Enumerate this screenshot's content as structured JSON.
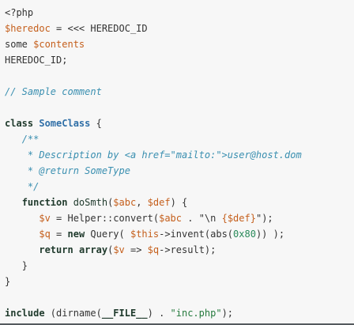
{
  "tokens": {
    "l1_open": "<?php",
    "l2_var": "$heredoc",
    "l2_rest": " = <<< HEREDOC_ID",
    "l3_text": "some ",
    "l3_var": "$contents",
    "l4_text": "HEREDOC_ID;",
    "l6_comment": "// Sample comment",
    "l8_kw": "class",
    "l8_cls": "SomeClass",
    "l8_rest": " {",
    "l9_doc": "/**",
    "l10_doc_a": " * Description by <a href=\"mailto:\">user@host.dom",
    "l11_doc": " * @return SomeType",
    "l12_doc": " */",
    "l13_kw": "function",
    "l13_fn": " doSmth",
    "l13_p1": "(",
    "l13_v1": "$abc",
    "l13_p2": ", ",
    "l13_v2": "$def",
    "l13_p3": ") {",
    "l14_var": "$v",
    "l14_a": " = Helper::",
    "l14_fn": "convert",
    "l14_b": "(",
    "l14_v2": "$abc",
    "l14_c": " . ",
    "l14_str1": "\"\\n ",
    "l14_strv": "{$def}",
    "l14_str2": "\"",
    "l14_d": ");",
    "l15_var": "$q",
    "l15_a": " = ",
    "l15_kw": "new",
    "l15_b": " Query( ",
    "l15_this": "$this",
    "l15_c": "->invent(abs(",
    "l15_num": "0x80",
    "l15_d": ")) );",
    "l16_kw1": "return",
    "l16_sp": " ",
    "l16_kw2": "array",
    "l16_a": "(",
    "l16_v1": "$v",
    "l16_b": " => ",
    "l16_v2": "$q",
    "l16_c": "->result);",
    "l17": "}",
    "l18": "}",
    "l20_kw": "include",
    "l20_a": " (dirname(",
    "l20_const": "__FILE__",
    "l20_b": ") . ",
    "l20_str": "\"inc.php\"",
    "l20_c": ");"
  },
  "colors": {
    "background": "#f7f7f7",
    "variable": "#c55f1c",
    "comment": "#3a8fb0",
    "keyword": "#1f3a2c",
    "class_name": "#2f6fa7",
    "string": "#257a3d",
    "number": "#2a8a5a"
  }
}
